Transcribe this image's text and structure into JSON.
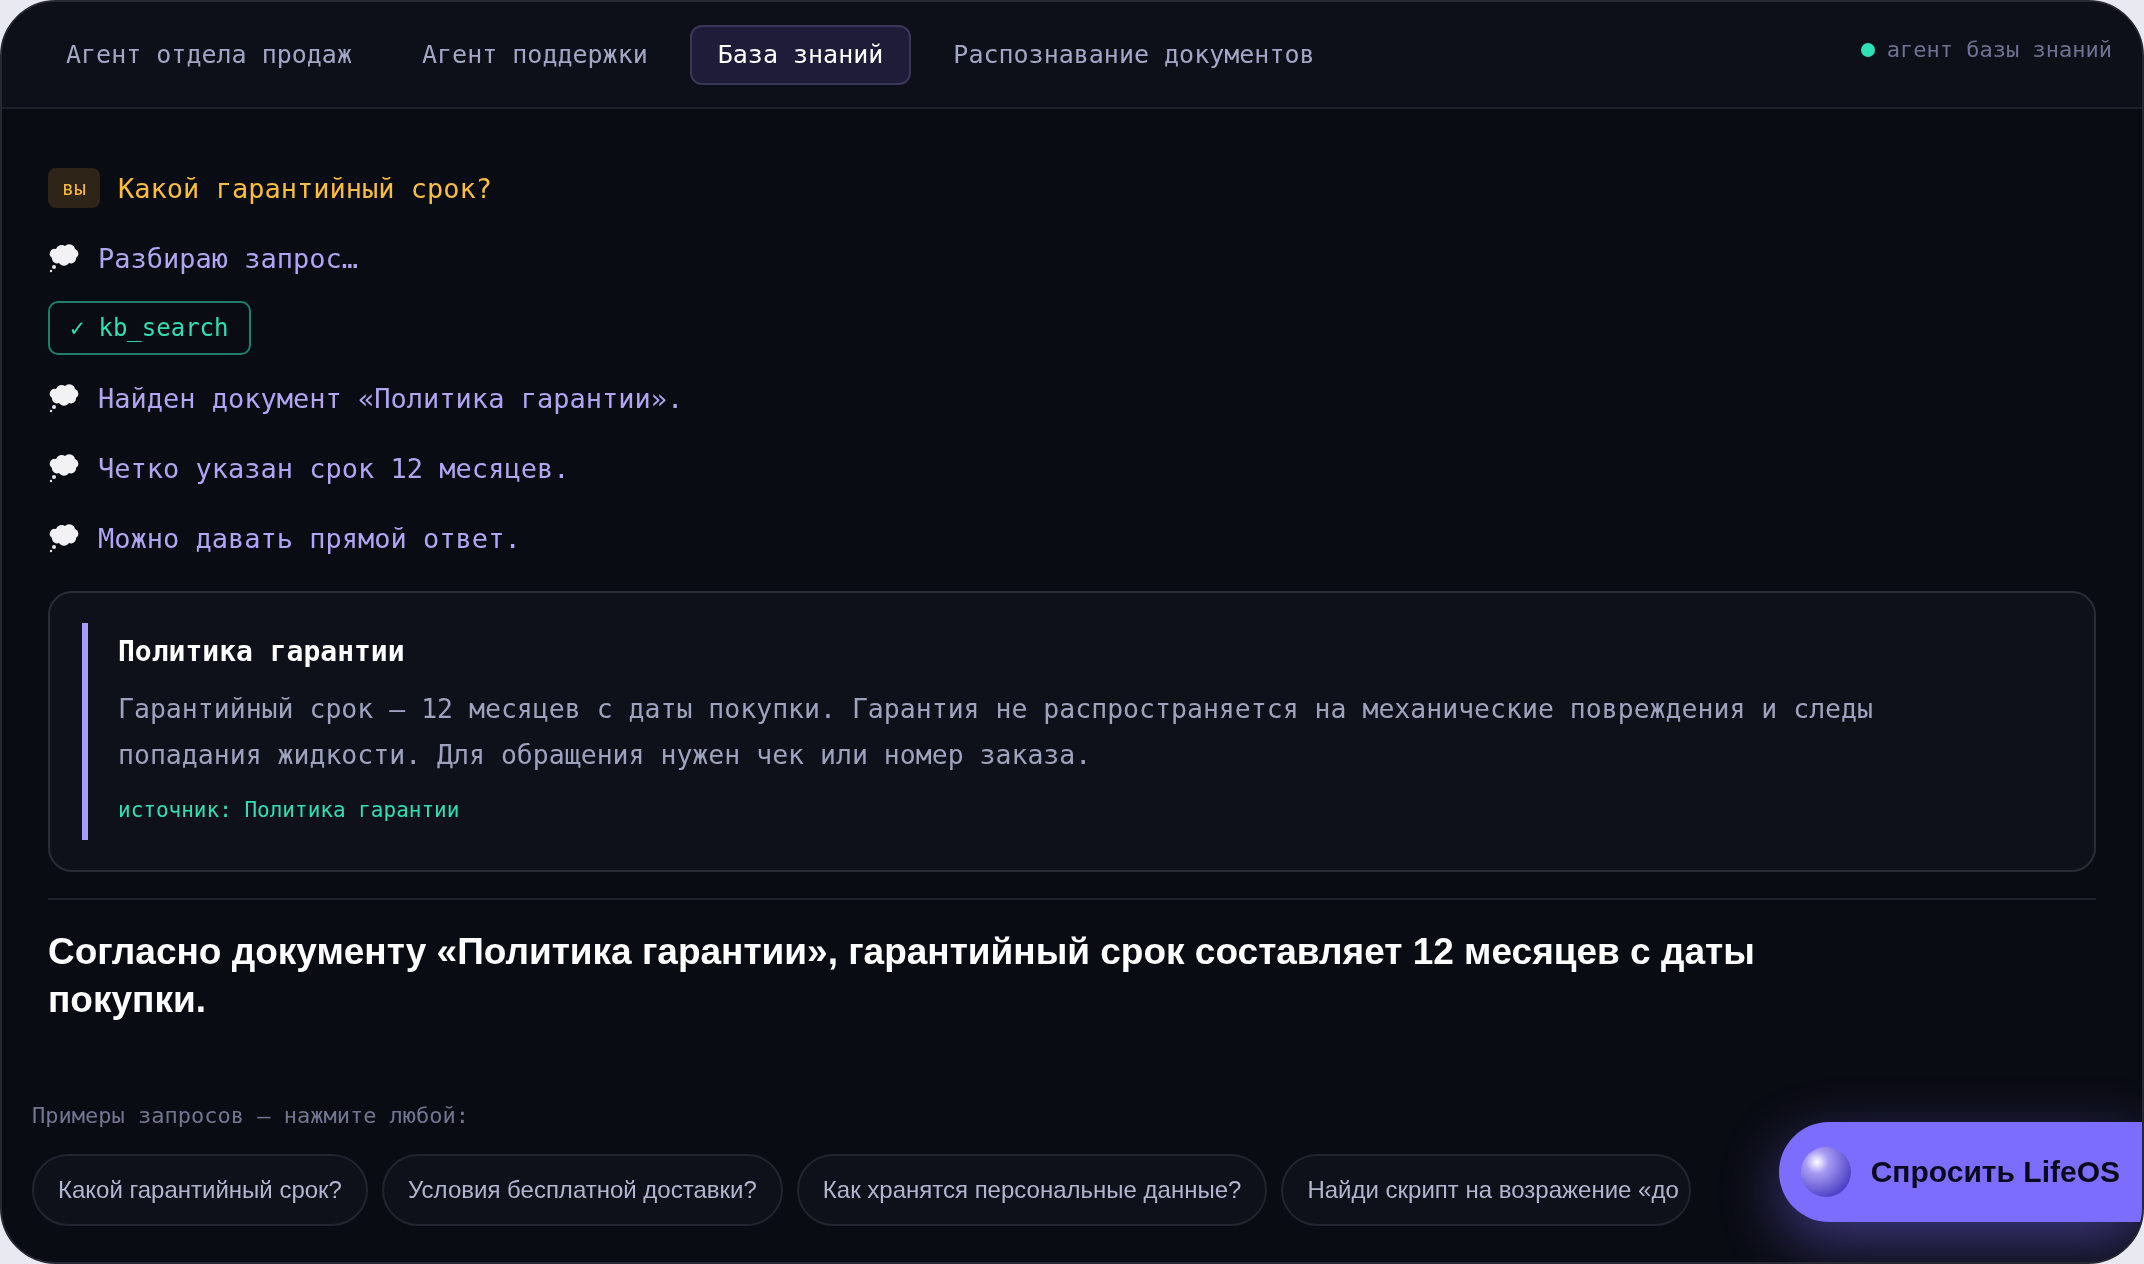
{
  "tabs": [
    {
      "label": "Агент отдела продаж",
      "selected": false
    },
    {
      "label": "Агент поддержки",
      "selected": false
    },
    {
      "label": "База знаний",
      "selected": true
    },
    {
      "label": "Распознавание документов",
      "selected": false
    }
  ],
  "status": {
    "label": "агент базы знаний"
  },
  "conversation": [
    {
      "kind": "user",
      "badge": "вы",
      "text": "Какой гарантийный срок?"
    },
    {
      "kind": "thought",
      "text": "Разбираю запрос…"
    },
    {
      "kind": "tool",
      "mark": "✓",
      "text": "kb_search"
    },
    {
      "kind": "thought",
      "text": "Найден документ «Политика гарантии»."
    },
    {
      "kind": "thought",
      "text": "Четко указан срок 12 месяцев."
    },
    {
      "kind": "thought",
      "text": "Можно давать прямой ответ."
    },
    {
      "kind": "document",
      "title": "Политика гарантии",
      "body": "Гарантийный срок — 12 месяцев с даты покупки. Гарантия не распространяется на механические повреждения и следы попадания жидкости. Для обращения нужен чек или номер заказа.",
      "source": "источник: Политика гарантии"
    }
  ],
  "answer": "Согласно документу «Политика гарантии», гарантийный срок составляет 12 месяцев с даты покупки.",
  "examples": {
    "label": "Примеры запросов — нажмите любой:",
    "chips": [
      "Какой гарантийный срок?",
      "Условия бесплатной доставки?",
      "Как хранятся персональные данные?",
      "Найди скрипт на возражение «до"
    ]
  },
  "ask_button": {
    "label": "Спросить LifeOS"
  }
}
